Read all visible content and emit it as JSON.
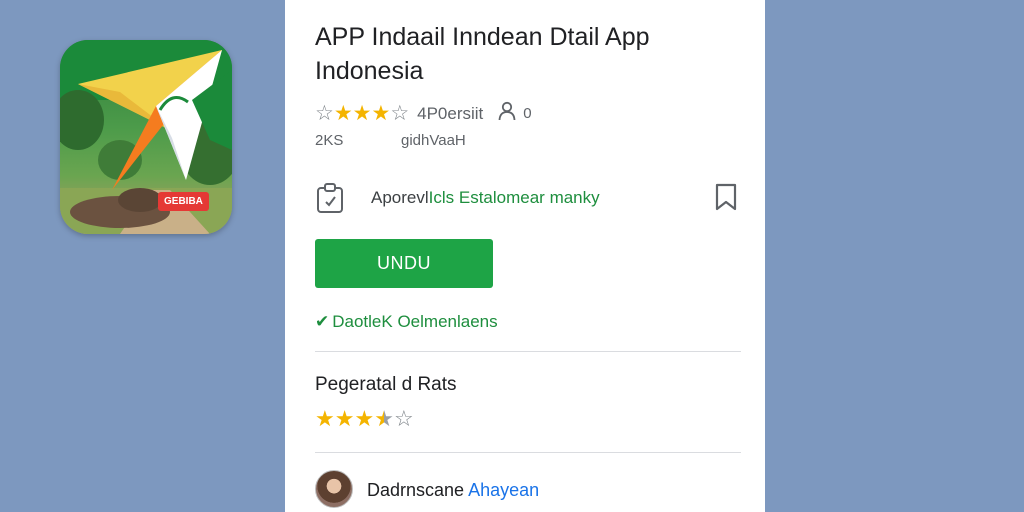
{
  "app_icon": {
    "badge_text": "GEBIBA",
    "colors": {
      "green": "#1b8a3a",
      "yellow": "#f2d24b",
      "orange": "#f57c1f",
      "red_badge": "#e53935"
    }
  },
  "app": {
    "title": "APP Indaail Inndean Dtail  App Indonesia",
    "rating_text": "4P0ersiit",
    "rating_count": "0",
    "stars_filled": 3,
    "stars_total": 5,
    "size": "2KS",
    "developer": "gidhVaaH",
    "info_text_prefix": "Aporevl",
    "info_text_accent": "Icls Estalomear manky",
    "install_label": "UNDU",
    "verified_label": "DaotleK Oelmenlaens",
    "accent_color": "#1ea446"
  },
  "ratings_section": {
    "title": "Pegeratal d Rats",
    "stars_value": 3.5
  },
  "review": {
    "name_prefix": "Dadrnscane",
    "name_accent": "Ahayean"
  },
  "icons": [
    "clipboard-icon",
    "bookmark-icon",
    "person-icon",
    "star-icon",
    "check-icon"
  ]
}
